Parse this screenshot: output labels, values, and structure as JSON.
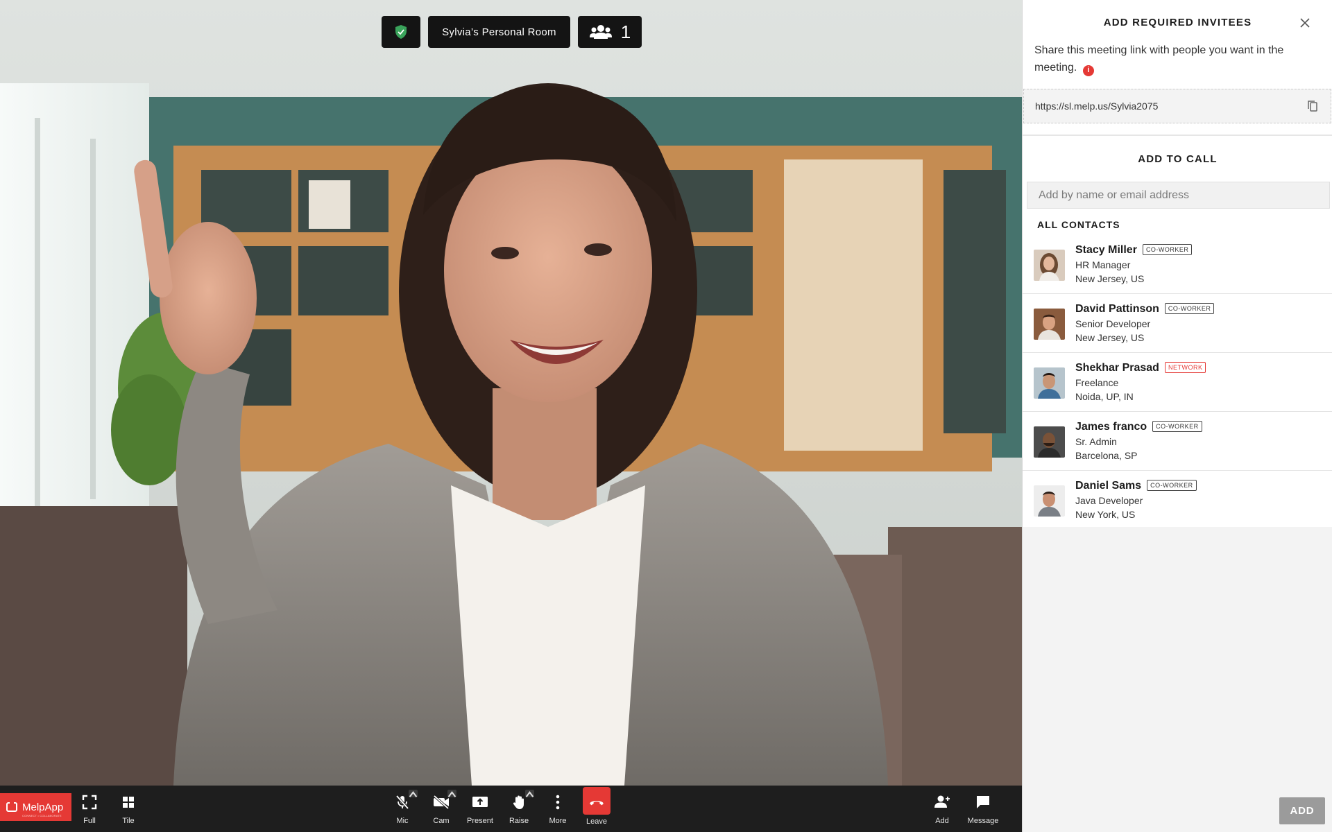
{
  "meeting": {
    "room_name": "Sylvia’s Personal Room",
    "participant_count": "1",
    "security_icon": "shield-check-icon",
    "participants_icon": "participants-icon"
  },
  "brand": {
    "name": "MelpApp",
    "tagline": "CONNECT • COLLABORATE",
    "color": "#e53935"
  },
  "toolbar": {
    "left": [
      {
        "label": "Full",
        "icon": "fullscreen-icon"
      },
      {
        "label": "Tile",
        "icon": "tile-icon"
      }
    ],
    "center": [
      {
        "label": "Mic",
        "icon": "mic-off-icon"
      },
      {
        "label": "Cam",
        "icon": "cam-off-icon"
      },
      {
        "label": "Present",
        "icon": "present-icon"
      },
      {
        "label": "Raise",
        "icon": "raise-hand-icon"
      },
      {
        "label": "More",
        "icon": "more-icon"
      },
      {
        "label": "Leave",
        "icon": "leave-call-icon"
      }
    ],
    "right": [
      {
        "label": "Add",
        "icon": "add-person-icon"
      },
      {
        "label": "Message",
        "icon": "message-icon"
      }
    ]
  },
  "panel": {
    "title": "ADD REQUIRED INVITEES",
    "share_text": "Share this meeting link with people you want in the meeting.",
    "info_glyph": "i",
    "link": "https://sl.melp.us/Sylvia2075",
    "add_to_call_title": "ADD TO CALL",
    "search_placeholder": "Add by name or email address",
    "contacts_title": "ALL CONTACTS",
    "contacts": [
      {
        "name": "Stacy Miller",
        "badge": "CO-WORKER",
        "role": "HR Manager",
        "location": "New Jersey, US"
      },
      {
        "name": "David Pattinson",
        "badge": "CO-WORKER",
        "role": "Senior Developer",
        "location": "New Jersey, US"
      },
      {
        "name": "Shekhar Prasad",
        "badge": "NETWORK",
        "role": "Freelance",
        "location": "Noida, UP, IN"
      },
      {
        "name": "James franco",
        "badge": "CO-WORKER",
        "role": "Sr. Admin",
        "location": "Barcelona, SP"
      },
      {
        "name": "Daniel Sams",
        "badge": "CO-WORKER",
        "role": "Java Developer",
        "location": "New York, US"
      }
    ],
    "add_button": "ADD"
  }
}
